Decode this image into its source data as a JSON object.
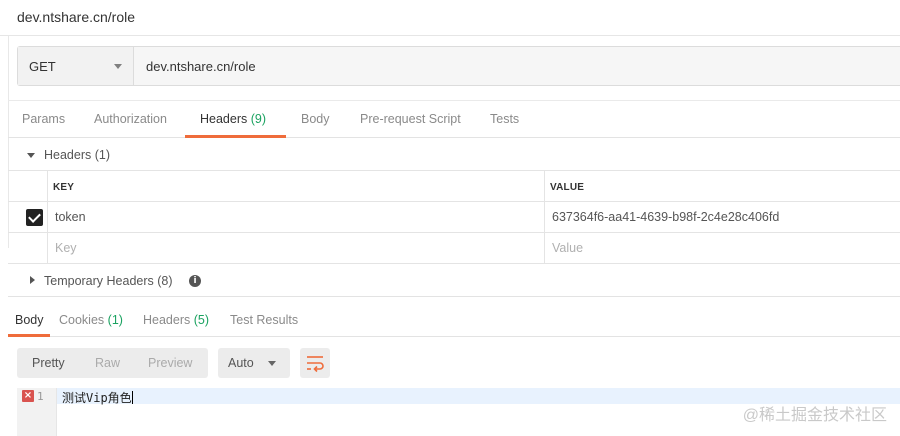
{
  "title": "dev.ntshare.cn/role",
  "request": {
    "method": "GET",
    "url": "dev.ntshare.cn/role"
  },
  "request_tabs": [
    {
      "label": "Params",
      "count": ""
    },
    {
      "label": "Authorization",
      "count": ""
    },
    {
      "label": "Headers",
      "count": "(9)"
    },
    {
      "label": "Body",
      "count": ""
    },
    {
      "label": "Pre-request Script",
      "count": ""
    },
    {
      "label": "Tests",
      "count": ""
    }
  ],
  "headers_section": {
    "title": "Headers (1)",
    "columns": {
      "key": "KEY",
      "value": "VALUE"
    },
    "rows": [
      {
        "checked": true,
        "key": "token",
        "value": "637364f6-aa41-4639-b98f-2c4e28c406fd"
      }
    ],
    "placeholder": {
      "key": "Key",
      "value": "Value"
    }
  },
  "temporary_headers": {
    "title": "Temporary Headers (8)"
  },
  "response_tabs": [
    {
      "label": "Body",
      "count": ""
    },
    {
      "label": "Cookies",
      "count": "(1)"
    },
    {
      "label": "Headers",
      "count": "(5)"
    },
    {
      "label": "Test Results",
      "count": ""
    }
  ],
  "view_modes": [
    "Pretty",
    "Raw",
    "Preview"
  ],
  "format_select": "Auto",
  "editor": {
    "line_number": "1",
    "content": "测试Vip角色"
  },
  "watermark": "@稀土掘金技术社区",
  "colors": {
    "accent": "#ef6c3b",
    "count_green": "#1aa260",
    "error_red": "#d9534f"
  },
  "icons": [
    "chevron-down-icon",
    "caret-right-icon",
    "checkbox-checked-icon",
    "info-icon",
    "wrap-lines-icon",
    "error-icon"
  ]
}
